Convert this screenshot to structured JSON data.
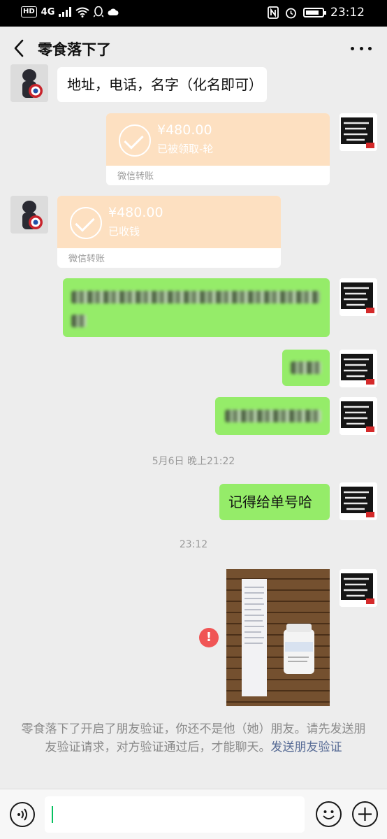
{
  "status_bar": {
    "network_badge": "HD",
    "network_type": "4G",
    "time": "23:12",
    "battery_level": 0.8
  },
  "header": {
    "title": "零食落下了"
  },
  "messages": {
    "m1_text": "地址，电话，名字（化名即可）",
    "t1": {
      "amount": "¥480.00",
      "status": "已被领取-轮",
      "footer": "微信转账"
    },
    "t2": {
      "amount": "¥480.00",
      "status": "已收钱",
      "footer": "微信转账"
    },
    "ts1": "5月6日 晚上21:22",
    "m6_text": "记得给单号哈",
    "ts2": "23:12"
  },
  "notice": {
    "text": "零食落下了开启了朋友验证，你还不是他（她）朋友。请先发送朋友验证请求，对方验证通过后，才能聊天。",
    "link": "发送朋友验证"
  },
  "icons": {
    "back": "back-arrow-icon",
    "more": "more-dots-icon",
    "voice": "voice-icon",
    "emoji": "emoji-icon",
    "plus": "plus-icon",
    "warning": "warning-icon"
  },
  "colors": {
    "chat_bg": "#ededed",
    "bubble_green": "#95ec69",
    "transfer_bg": "#fde0c1",
    "link": "#576b95",
    "warning": "#f05555"
  }
}
